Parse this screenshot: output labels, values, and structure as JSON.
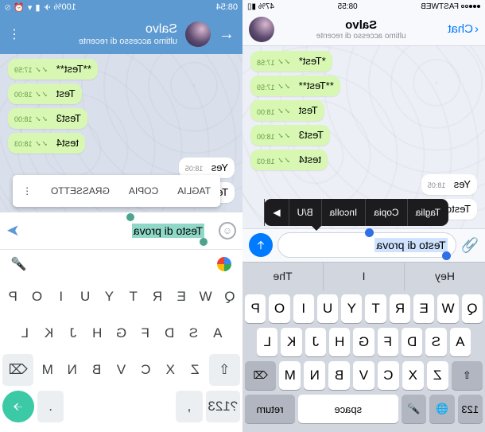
{
  "ios": {
    "status": {
      "carrier": "FASTWEB",
      "time": "08:55",
      "battery": "47%"
    },
    "header": {
      "back": "Chat",
      "title": "Salvo",
      "subtitle": "ultimo accesso di recente"
    },
    "messages": [
      {
        "dir": "out",
        "text": "*Test*",
        "time": "17:58"
      },
      {
        "dir": "out",
        "text": "**Test**",
        "time": "17:59"
      },
      {
        "dir": "out",
        "text": "Test",
        "time": "18:00"
      },
      {
        "dir": "out",
        "text": "Test3",
        "time": "18:00"
      },
      {
        "dir": "out",
        "text": "test4",
        "time": "18:03"
      },
      {
        "dir": "in",
        "text": "Yes",
        "time": "18:05"
      },
      {
        "dir": "in",
        "text": "Testo",
        "time": "18:05"
      }
    ],
    "popover": [
      "Taglia",
      "Copia",
      "Incolla",
      "B/U",
      "▶"
    ],
    "input_text": "Testo di prova",
    "quicktype": [
      "Hey",
      "I",
      "The"
    ],
    "keyboard": {
      "r1": [
        "Q",
        "W",
        "E",
        "R",
        "T",
        "Y",
        "U",
        "I",
        "O",
        "P"
      ],
      "r2": [
        "A",
        "S",
        "D",
        "F",
        "G",
        "H",
        "J",
        "K",
        "L"
      ],
      "r3": [
        "Z",
        "X",
        "C",
        "V",
        "B",
        "N",
        "M"
      ],
      "shift": "⇧",
      "bksp": "⌫",
      "r4": {
        "num": "123",
        "globe": "🌐",
        "mic": "🎤",
        "space": "space",
        "ret": "return"
      }
    }
  },
  "android": {
    "status": {
      "time": "08:54",
      "battery": "100%"
    },
    "header": {
      "title": "Salvo",
      "subtitle": "ultimo accesso di recente"
    },
    "messages": [
      {
        "dir": "out",
        "text": "**Test**",
        "time": "17:59"
      },
      {
        "dir": "out",
        "text": "Test",
        "time": "18:00"
      },
      {
        "dir": "out",
        "text": "Test3",
        "time": "18:00"
      },
      {
        "dir": "out",
        "text": "test4",
        "time": "18:03"
      },
      {
        "dir": "in",
        "text": "Yes",
        "time": "18:05"
      },
      {
        "dir": "in",
        "text": "Testo",
        "time": ""
      }
    ],
    "context": [
      "TAGLIA",
      "COPIA",
      "GRASSETTO",
      "⋮"
    ],
    "input_text": "Testo di prova",
    "keyboard": {
      "r1": [
        "Q",
        "W",
        "E",
        "R",
        "T",
        "Y",
        "U",
        "I",
        "O",
        "P"
      ],
      "r2": [
        "A",
        "S",
        "D",
        "F",
        "G",
        "H",
        "J",
        "K",
        "L"
      ],
      "r3": [
        "Z",
        "X",
        "C",
        "V",
        "B",
        "N",
        "M"
      ],
      "shift": "⇧",
      "bksp": "⌫",
      "r4": {
        "num": "?123",
        "comma": ",",
        "dot": ".",
        "go": "→"
      },
      "mic": "🎤"
    }
  }
}
